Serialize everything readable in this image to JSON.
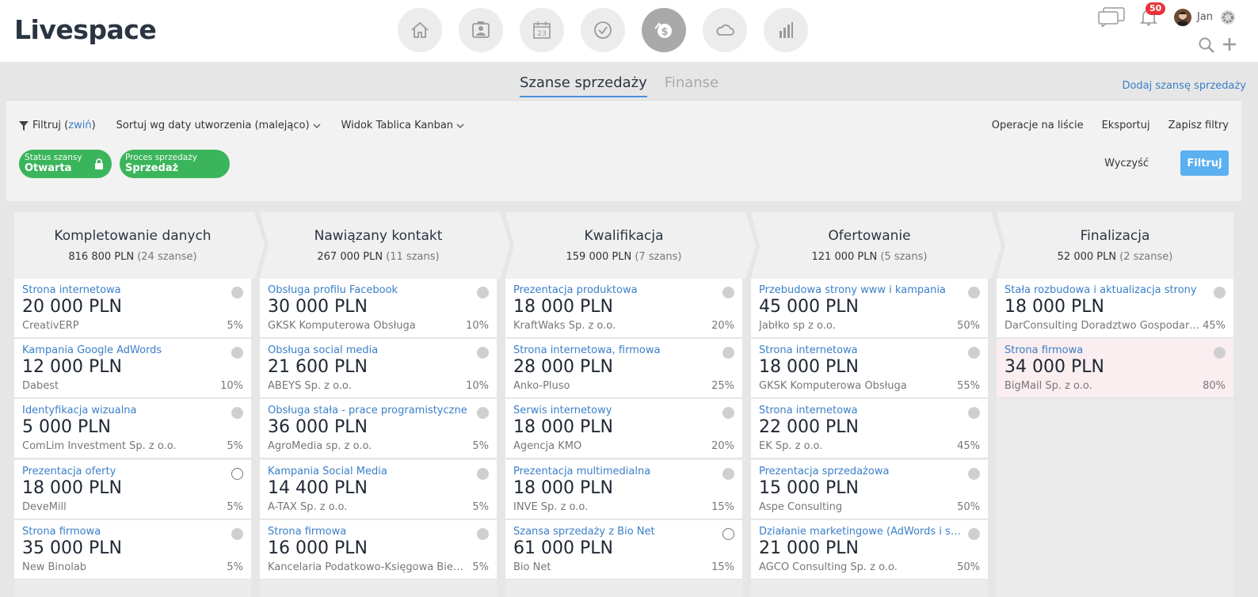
{
  "app": {
    "logo": "Livespace"
  },
  "nav": [
    {
      "icon": "home-icon"
    },
    {
      "icon": "contacts-icon"
    },
    {
      "icon": "calendar-icon",
      "text": "23"
    },
    {
      "icon": "tasks-check-icon"
    },
    {
      "icon": "deals-dollar-icon",
      "active": true
    },
    {
      "icon": "cloud-icon"
    },
    {
      "icon": "reports-chart-icon"
    }
  ],
  "header": {
    "notifications_count": "50",
    "user_name": "Jan"
  },
  "tabs": [
    {
      "label": "Szanse sprzedaży",
      "active": true
    },
    {
      "label": "Finanse",
      "active": false
    }
  ],
  "add_link": "Dodaj szansę sprzedaży",
  "filters": {
    "filter_label": "Filtruj (",
    "collapse_label": "zwiń",
    "filter_close": ")",
    "sort_label": "Sortuj wg daty utworzenia (malejąco)",
    "view_label": "Widok Tablica Kanban",
    "list_ops": "Operacje na liście",
    "export": "Eksportuj",
    "save_filters": "Zapisz filtry",
    "clear": "Wyczyść",
    "apply": "Filtruj",
    "chips": [
      {
        "label": "Status szansy",
        "value": "Otwarta",
        "locked": true
      },
      {
        "label": "Proces sprzedaży",
        "value": "Sprzedaż",
        "locked": false
      }
    ]
  },
  "columns": [
    {
      "title": "Kompletowanie danych",
      "sum": "816 800 PLN",
      "count": "(24 szanse)",
      "cards": [
        {
          "name": "Strona internetowa",
          "amount": "20 000 PLN",
          "company": "CreativERP",
          "pct": "5%",
          "dot": "filled"
        },
        {
          "name": "Kampania Google AdWords",
          "amount": "12 000 PLN",
          "company": "Dabest",
          "pct": "10%",
          "dot": "filled"
        },
        {
          "name": "Identyfikacja wizualna",
          "amount": "5 000 PLN",
          "company": "ComLim Investment Sp. z o.o.",
          "pct": "5%",
          "dot": "filled"
        },
        {
          "name": "Prezentacja oferty",
          "amount": "18 000 PLN",
          "company": "DeveMill",
          "pct": "5%",
          "dot": "empty"
        },
        {
          "name": "Strona firmowa",
          "amount": "35 000 PLN",
          "company": "New Binolab",
          "pct": "5%",
          "dot": "filled"
        }
      ]
    },
    {
      "title": "Nawiązany kontakt",
      "sum": "267 000 PLN",
      "count": "(11 szans)",
      "cards": [
        {
          "name": "Obsługa profilu Facebook",
          "amount": "30 000 PLN",
          "company": "GKSK Komputerowa Obsługa",
          "pct": "10%",
          "dot": "filled"
        },
        {
          "name": "Obsługa social media",
          "amount": "21 600 PLN",
          "company": "ABEYS Sp. z o.o.",
          "pct": "10%",
          "dot": "filled"
        },
        {
          "name": "Obsługa stała - prace programistyczne",
          "amount": "36 000 PLN",
          "company": "AgroMedia sp. z o.o.",
          "pct": "5%",
          "dot": "filled"
        },
        {
          "name": "Kampania Social Media",
          "amount": "14 400 PLN",
          "company": "A-TAX Sp. z o.o.",
          "pct": "5%",
          "dot": "filled"
        },
        {
          "name": "Strona firmowa",
          "amount": "16 000 PLN",
          "company": "Kancelaria Podatkowo-Księgowa Bierna...",
          "pct": "5%",
          "dot": "filled"
        }
      ]
    },
    {
      "title": "Kwalifikacja",
      "sum": "159 000 PLN",
      "count": "(7 szans)",
      "cards": [
        {
          "name": "Prezentacja produktowa",
          "amount": "18 000 PLN",
          "company": "KraftWaks Sp. z o.o.",
          "pct": "20%",
          "dot": "filled"
        },
        {
          "name": "Strona internetowa, firmowa",
          "amount": "28 000 PLN",
          "company": "Anko-Pluso",
          "pct": "25%",
          "dot": "filled"
        },
        {
          "name": "Serwis internetowy",
          "amount": "18 000 PLN",
          "company": "Agencja KMO",
          "pct": "20%",
          "dot": "filled"
        },
        {
          "name": "Prezentacja multimedialna",
          "amount": "18 000 PLN",
          "company": "INVE Sp. z o.o.",
          "pct": "15%",
          "dot": "filled"
        },
        {
          "name": "Szansa sprzedaży z Bio Net",
          "amount": "61 000 PLN",
          "company": "Bio Net",
          "pct": "15%",
          "dot": "empty"
        }
      ]
    },
    {
      "title": "Ofertowanie",
      "sum": "121 000 PLN",
      "count": "(5 szans)",
      "cards": [
        {
          "name": "Przebudowa strony www i kampania",
          "amount": "45 000 PLN",
          "company": "Jabłko sp z o.o.",
          "pct": "50%",
          "dot": "filled"
        },
        {
          "name": "Strona internetowa",
          "amount": "18 000 PLN",
          "company": "GKSK Komputerowa Obsługa",
          "pct": "55%",
          "dot": "filled"
        },
        {
          "name": "Strona internetowa",
          "amount": "22 000 PLN",
          "company": "EK Sp. z o.o.",
          "pct": "45%",
          "dot": "filled"
        },
        {
          "name": "Prezentacja sprzedażowa",
          "amount": "15 000 PLN",
          "company": "Aspe Consulting",
          "pct": "50%",
          "dot": "filled"
        },
        {
          "name": "Działanie marketingowe (AdWords i soc...",
          "amount": "21 000 PLN",
          "company": "AGCO Consulting Sp. z o.o.",
          "pct": "50%",
          "dot": "filled"
        }
      ]
    },
    {
      "title": "Finalizacja",
      "sum": "52 000 PLN",
      "count": "(2 szanse)",
      "cards": [
        {
          "name": "Stała rozbudowa i aktualizacja strony",
          "amount": "18 000 PLN",
          "company": "DarConsulting Doradztwo Gospodarcze",
          "pct": "45%",
          "dot": "filled"
        },
        {
          "name": "Strona firmowa",
          "amount": "34 000 PLN",
          "company": "BigMail Sp. z o.o.",
          "pct": "80%",
          "dot": "filled",
          "highlight": true
        }
      ]
    }
  ]
}
